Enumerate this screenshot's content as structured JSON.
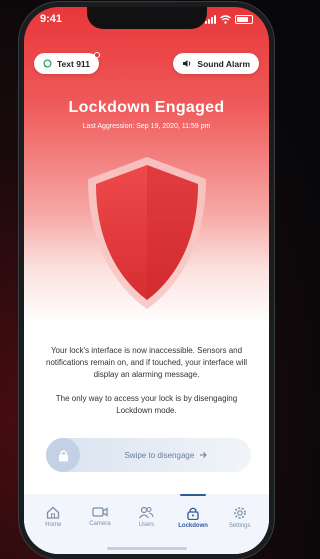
{
  "status_bar": {
    "time": "9:41"
  },
  "top_actions": {
    "text_911_label": "Text 911",
    "sound_alarm_label": "Sound Alarm"
  },
  "header": {
    "title": "Lockdown Engaged",
    "subtitle": "Last Aggression: Sep 19, 2020, 11:59 pm"
  },
  "body": {
    "message_1": "Your lock's interface is now inaccessible. Sensors and notifications remain on, and if touched, your interface will display an alarming message.",
    "message_2": "The only way to access your lock is by disengaging Lockdown mode."
  },
  "swipe": {
    "label": "Swipe to disengage"
  },
  "tabs": [
    {
      "label": "Home",
      "icon": "home-icon"
    },
    {
      "label": "Camera",
      "icon": "camera-icon"
    },
    {
      "label": "Users",
      "icon": "users-icon"
    },
    {
      "label": "Lockdown",
      "icon": "lock-icon",
      "active": true
    },
    {
      "label": "Settings",
      "icon": "gear-icon"
    }
  ],
  "colors": {
    "alert_red": "#e8363a",
    "tab_active": "#2e5a9a",
    "tab_inactive": "#7b8fab"
  }
}
